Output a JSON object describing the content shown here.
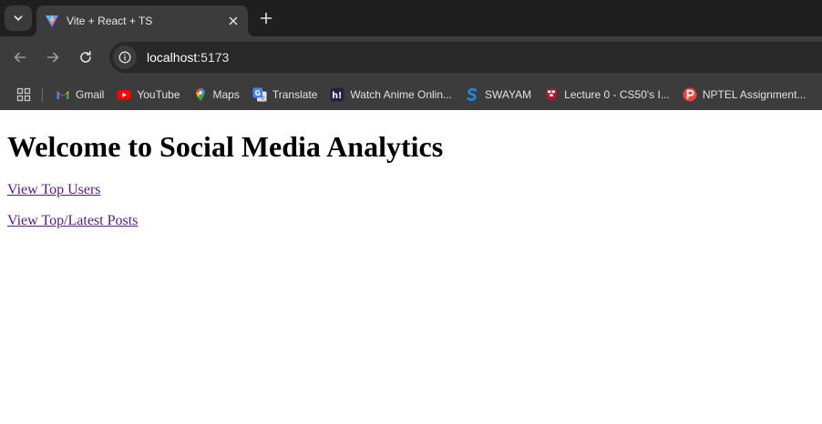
{
  "browser": {
    "tab": {
      "title": "Vite + React + TS",
      "favicon": "vite-logo-icon"
    },
    "address_bar": {
      "host": "localhost",
      "port": ":5173"
    },
    "bookmarks": [
      {
        "label": "Gmail",
        "icon": "gmail-icon"
      },
      {
        "label": "YouTube",
        "icon": "youtube-icon"
      },
      {
        "label": "Maps",
        "icon": "maps-icon"
      },
      {
        "label": "Translate",
        "icon": "translate-icon"
      },
      {
        "label": "Watch Anime Onlin...",
        "icon": "hianime-icon"
      },
      {
        "label": "SWAYAM",
        "icon": "swayam-icon"
      },
      {
        "label": "Lecture 0 - CS50's I...",
        "icon": "harvard-icon"
      },
      {
        "label": "NPTEL Assignment...",
        "icon": "nptel-icon"
      }
    ]
  },
  "page": {
    "heading": "Welcome to Social Media Analytics",
    "links": [
      {
        "label": "View Top Users"
      },
      {
        "label": "View Top/Latest Posts"
      }
    ]
  },
  "colors": {
    "tabstrip": "#1f1f1f",
    "toolbar": "#3c3c3c",
    "omnibox": "#282828",
    "visited_link": "#551a8b"
  }
}
